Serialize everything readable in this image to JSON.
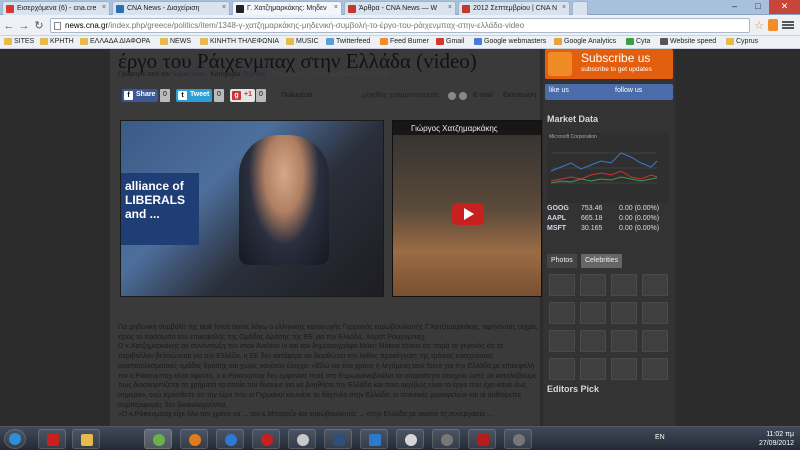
{
  "browser": {
    "tabs": [
      {
        "label": "Εισερχόμενα (6) - cna.cre",
        "fav_color": "#d23a2f",
        "active": false
      },
      {
        "label": "CNA News - Διαχείριση",
        "fav_color": "#2a6fb5",
        "active": false
      },
      {
        "label": "Γ. Χατζημαρκάκης: Μηδεν",
        "fav_color": "#222222",
        "active": true
      },
      {
        "label": "Άρθρα - CNA News — W",
        "fav_color": "#c0392b",
        "active": false
      },
      {
        "label": "2012 Σεπτεμβρίου | CNA N",
        "fav_color": "#c0392b",
        "active": false
      }
    ],
    "window_buttons": {
      "minimize": "–",
      "maximize": "□",
      "close": "✕"
    },
    "nav": {
      "back": "←",
      "forward": "→",
      "reload": "↻"
    },
    "address": {
      "domain": "news.cna.gr",
      "path": "/index.php/greece/politics/item/1348-γ-χατζημαρκάκης-μηδενική-συμβολή-το-έργο-του-ράιχενμπαχ-στην-ελλάδα-video"
    },
    "star": "☆",
    "bookmarks": [
      "SITES",
      "ΚΡΗΤΗ",
      "ΕΛΛΑΔΑ ΔΙΑΦΟΡΑ",
      "NEWS",
      "ΚΙΝΗΤΗ ΤΗΛΕΦΩΝΙΑ",
      "MUSIC",
      "Twitterfeed",
      "Feed Burner",
      "Gmail",
      "Google webmasters",
      "Google Analytics",
      "Cyta",
      "Website speed",
      "Cyprus"
    ]
  },
  "article": {
    "headline": "έργο του Ράιχενμπαχ στην Ελλάδα (video)",
    "meta": {
      "written_by": "Γράφτηκε από τον",
      "author": "Super User",
      "category_label": "Κατηγορία",
      "category": "Πολιτική",
      "date": "Παρασκευή, 14 Σεπτεμβρίου 2012 00:00"
    },
    "share": {
      "fb_label": "Share",
      "fb_count": "0",
      "tw_label": "Tweet",
      "tw_count": "0",
      "gp_label": "+1",
      "gp_count": "0",
      "multimedia": "Πολυμέσα",
      "font_size": "μέγεθος γραμματοσειράς",
      "email": "E-mail",
      "print": "Εκτύπωση"
    },
    "photo_banner": "alliance of LIBERALS and ...",
    "video_title": "Γιώργος Χατζημαρκάκης",
    "paragraphs": [
      "Για μηδενική συμβολή της task force έκανε λόγω ο ελληνικής καταγωγής Γερμανός ευρωβουλευτής Γ.Χατζημαρκάκης, αφήνοντας αιχμές προς το πρόσωπο του επικεφαλής της Ομάδας Δράσης της ΕΕ για την Ελλάδα, Χορστ Ράιχενμπαχ.",
      "Ο κ.Χατζημαρκάκης σε συνέντευξη του στον Ανελίου Ιν και τον δημοσιογράφο Μάκη Μάκκα τόνισε ότι παρά το γεγονός ότι το περιβάλλον βελτιώνεται για την Ελλάδα, η ΕΕ δεν κατάφερε να διορθώσει την λάθος προσέγγιση της τρόικας ενισχύοντας αναποτελεσματικές ομάδες δράσης και χωρίς κανέναν έλεγχο: «Εδώ και ένα χρόνο η λεγόμενη task force για την Ελλάδα με επικεφαλή τον κ.Ράικενμπαχ είναι άφαντη, ο κ.Ράικενμπαχ δεν εμφάνισε ποτέ στο Ευρωκοινοβούλιο τα απαραίτητα στοιχεία ώστε να καταλάβουμε πως διασκορπίζεται τα χρήματα τα οποία του δίνουμε για να βοηθήσει την Ελλάδα και ποιο ακριβώς είναι το έργο που έχει κάνει έως σήμερα», ενώ πρόσθεσε ότι την ώρα που οι Γερμανοί κουνάνε το δάχτυλο στην Ελλάδα, οι πολιτικές ρουσφετιών και οι αυθαίρετες συμπεριφορές δεν δικαιολογούνται.",
      "«Ο κ.Ράικενμπαχ είχε όλο τον χρόνο να ... τον κ.Μπαρόζο και ευρωβουλευτές ... στην Ελλάδα με σκοπό τη συνεργασία ..."
    ]
  },
  "sidebar": {
    "rss_title": "Subscribe us",
    "rss_sub": "subscribe to get updates",
    "fb_like": "like us",
    "fb_follow": "follow us",
    "market_title": "Market Data",
    "chart_caption": "Microsoft Corporation",
    "stocks": [
      {
        "sym": "GOOG",
        "price": "753.46",
        "change": "0.00 (0.00%)"
      },
      {
        "sym": "AAPL",
        "price": "665.18",
        "change": "0.00 (0.00%)"
      },
      {
        "sym": "MSFT",
        "price": "30.165",
        "change": "0.00 (0.00%)"
      }
    ],
    "photo_tabs": [
      "Photos",
      "Celebrities"
    ],
    "editors_pick": "Editors Pick"
  },
  "taskbar": {
    "lang": "EN",
    "time": "11:02 πμ",
    "date": "27/09/2012",
    "apps": [
      {
        "name": "start",
        "color": "#2f8fd6"
      },
      {
        "name": "pdf",
        "color": "#c81f1f"
      },
      {
        "name": "folder",
        "color": "#e8b94b"
      },
      {
        "name": "chrome",
        "color": "#6ab04c"
      },
      {
        "name": "firefox",
        "color": "#e37b1c"
      },
      {
        "name": "media",
        "color": "#2d7ad6"
      },
      {
        "name": "opera",
        "color": "#c81f1f"
      },
      {
        "name": "app8",
        "color": "#c9c9c9"
      },
      {
        "name": "app9",
        "color": "#2e4f7a"
      },
      {
        "name": "photoshop",
        "color": "#2b7ad0"
      },
      {
        "name": "app11",
        "color": "#d6d6d6"
      },
      {
        "name": "filezilla",
        "color": "#b71c1c"
      },
      {
        "name": "app13",
        "color": "#777777"
      }
    ]
  }
}
